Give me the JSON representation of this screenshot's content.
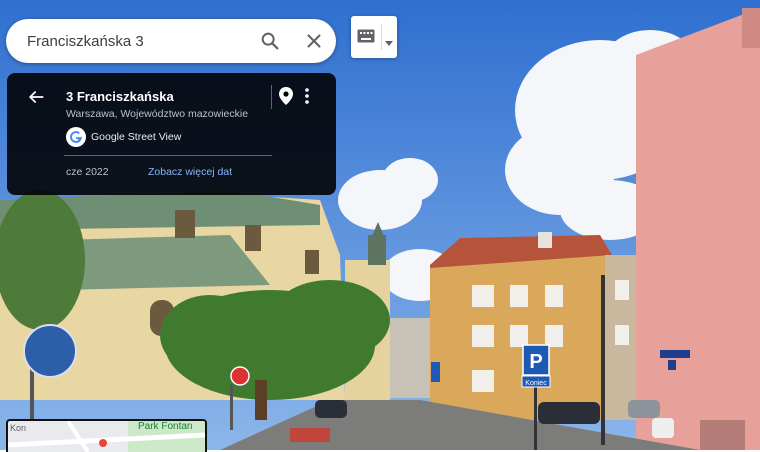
{
  "search": {
    "value": "Franciszkańska 3"
  },
  "info_card": {
    "title": "3 Franciszkańska",
    "subtitle": "Warszawa, Województwo mazowieckie",
    "provider": "Google Street View",
    "date": "cze 2022",
    "more_dates_link": "Zobacz więcej dat"
  },
  "scene": {
    "parking_sign": "P",
    "parking_subsign": "Koniec"
  },
  "minimap": {
    "park_label": "Park Fontan",
    "street_label": "Kon"
  },
  "colors": {
    "card_bg": "#000000",
    "link_blue": "#8ab4f8",
    "sky": "#4a86d8"
  }
}
